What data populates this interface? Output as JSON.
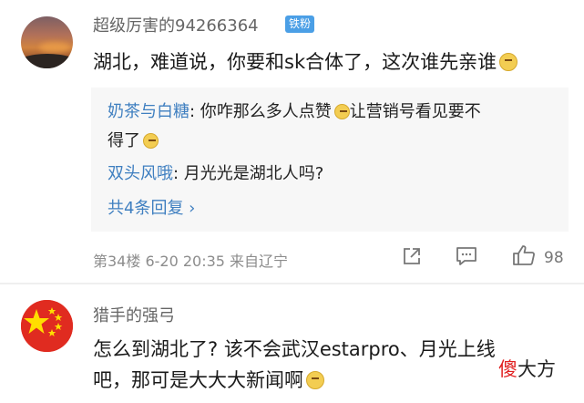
{
  "comment1": {
    "username": "超级厉害的94266364",
    "badge": "铁粉",
    "text": "湖北，难道说，你要和sk合体了，这次谁先亲谁",
    "replies": [
      {
        "name": "奶茶与白糖",
        "sep": ": ",
        "text_line1": "你咋那么多人点赞",
        "text_line1b": "让营销号看见要不",
        "text_line2": "得了"
      },
      {
        "name": "双头风哦",
        "sep": ": ",
        "text": "月光光是湖北人吗?"
      }
    ],
    "more_replies": "共4条回复 ›",
    "meta": "第34楼  6-20 20:35  来自辽宁",
    "like_count": "98"
  },
  "comment2": {
    "username": "猎手的强弓",
    "text_line1": "怎么到湖北了? 该不会武汉estarpro、月光上线",
    "text_line2": "吧，那可是大大大新闻啊"
  },
  "watermark": {
    "part1": "傻",
    "part2": "大方"
  },
  "colors": {
    "link": "#3f7fc0",
    "badge": "#4b9fe6",
    "flag": "#e02b20",
    "star": "#ffde00"
  },
  "icons": [
    "share-icon",
    "comment-icon",
    "like-icon",
    "emoji-doge-icon",
    "emoji-laugh-icon",
    "emoji-smirk-icon"
  ]
}
